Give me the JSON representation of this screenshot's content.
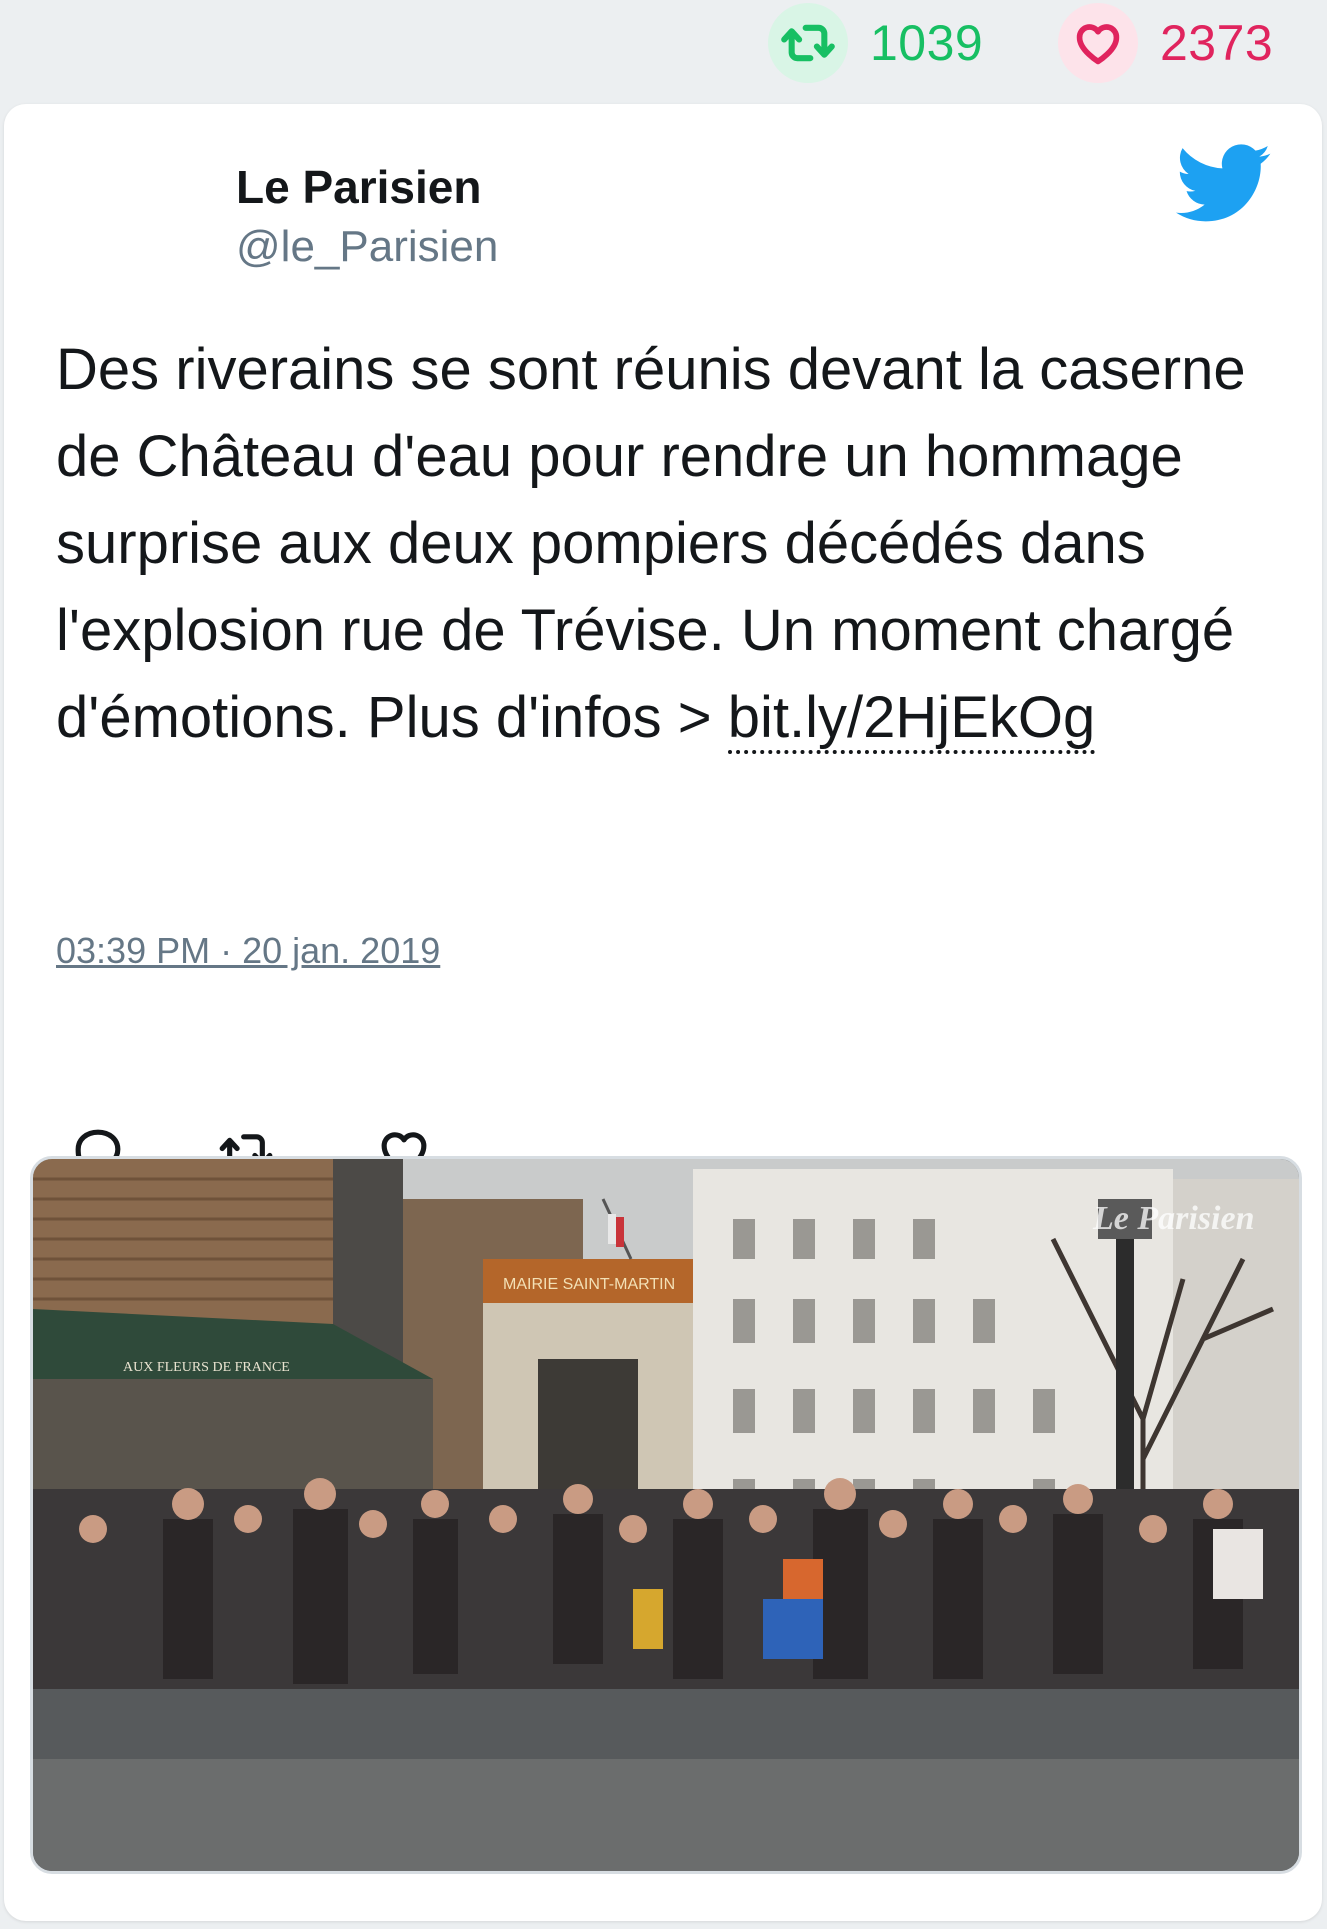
{
  "stats": {
    "retweet_count": "1039",
    "like_count": "2373",
    "retweet_icon": "retweet-icon",
    "like_icon": "heart-icon"
  },
  "tweet": {
    "author_name": "Le Parisien",
    "author_handle": "@le_Parisien",
    "text_before_link": "Des riverains se sont réunis devant la caserne de Château d'eau pour rendre un hommage surprise aux deux pompiers décédés dans l'explosion rue de Trévise. Un moment chargé d'émotions. Plus d'infos > ",
    "link_text": "bit.ly/2HjEkOg",
    "timestamp": "03:39 PM · 20 jan. 2019",
    "brand_icon": "twitter-bird-icon"
  },
  "actions": {
    "reply_icon": "reply-icon",
    "retweet_icon": "retweet-icon",
    "like_icon": "heart-icon"
  },
  "media": {
    "watermark": "Le Parisien",
    "awning_text": "AUX FLEURS DE FRANCE",
    "sign_text": "MAIRIE SAINT-MARTIN"
  },
  "colors": {
    "retweet_green": "#17bf63",
    "like_pink": "#e0245e",
    "twitter_blue": "#1da1f2",
    "muted_gray": "#657786"
  }
}
